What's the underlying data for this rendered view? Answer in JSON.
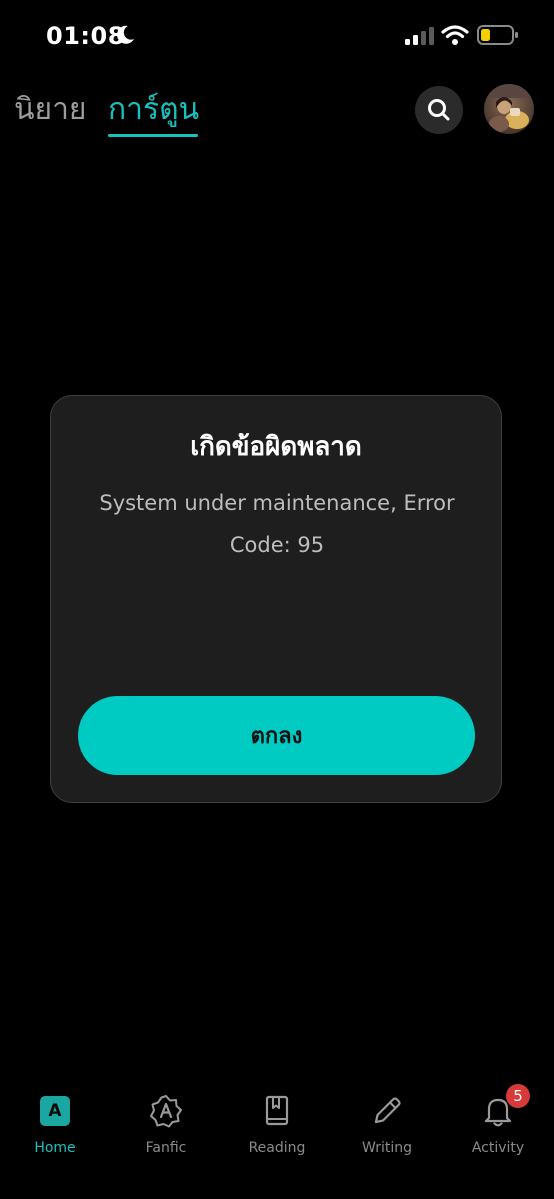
{
  "status_bar": {
    "time": "01:08"
  },
  "top_nav": {
    "tabs": [
      {
        "label": "นิยาย",
        "active": false
      },
      {
        "label": "การ์ตูน",
        "active": true
      }
    ]
  },
  "dialog": {
    "title": "เกิดข้อผิดพลาด",
    "message": "System under maintenance, Error Code: 95",
    "ok_label": "ตกลง"
  },
  "bottom_nav": {
    "items": [
      {
        "label": "Home",
        "icon": "home-icon",
        "active": true
      },
      {
        "label": "Fanfic",
        "icon": "fanfic-icon",
        "active": false
      },
      {
        "label": "Reading",
        "icon": "book-icon",
        "active": false
      },
      {
        "label": "Writing",
        "icon": "pencil-icon",
        "active": false
      },
      {
        "label": "Activity",
        "icon": "bell-icon",
        "active": false,
        "badge": "5"
      }
    ]
  },
  "colors": {
    "accent": "#16c2bd",
    "button": "#00cbc3",
    "dialog_bg": "#1e1e1e",
    "badge": "#d83a3a"
  }
}
